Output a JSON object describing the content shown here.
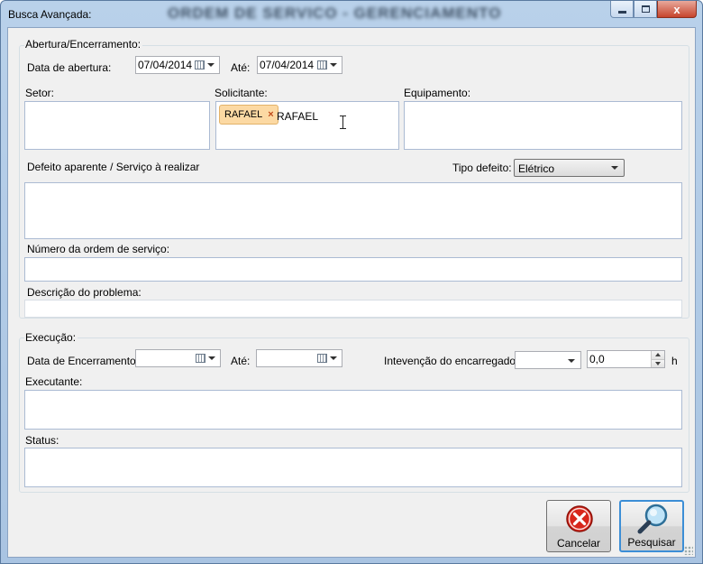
{
  "window": {
    "title": "Busca Avançada:",
    "blurred_title": "ORDEM DE SERVICO - GERENCIAMENTO",
    "close_glyph": "x"
  },
  "abertura": {
    "group_label": "Abertura/Encerramento:",
    "data_label": "Data de abertura:",
    "data_value": "07/04/2014",
    "ate_label": "Até:",
    "ate_value": "07/04/2014"
  },
  "setor": {
    "label": "Setor:"
  },
  "solicitante": {
    "label": "Solicitante:",
    "tag": "RAFAEL",
    "tag_remove": "×",
    "typed": "RAFAEL"
  },
  "equipamento": {
    "label": "Equipamento:"
  },
  "defeito": {
    "label": "Defeito aparente / Serviço à realizar",
    "tipo_label": "Tipo defeito:",
    "tipo_value": "Elétrico"
  },
  "numero": {
    "label": "Número da ordem de serviço:"
  },
  "descricao": {
    "label": "Descrição do problema:"
  },
  "execucao": {
    "group_label": "Execução:",
    "encerramento_label": "Data de Encerramento:",
    "ate_label": "Até:",
    "intervencao_label": "Intevenção do encarregado:",
    "hours_value": "0,0",
    "hours_unit": "h"
  },
  "executante": {
    "label": "Executante:"
  },
  "status": {
    "label": "Status:"
  },
  "buttons": {
    "cancel": "Cancelar",
    "search": "Pesquisar"
  },
  "icons": {
    "cancel": "cancel-icon",
    "search": "search-icon",
    "calendar": "calendar-icon"
  },
  "colors": {
    "title_bar": "#b9d1ea",
    "tag_bg": "#fcd9a3",
    "cancel_red": "#d8261b",
    "focus_border": "#3c8ed6"
  }
}
